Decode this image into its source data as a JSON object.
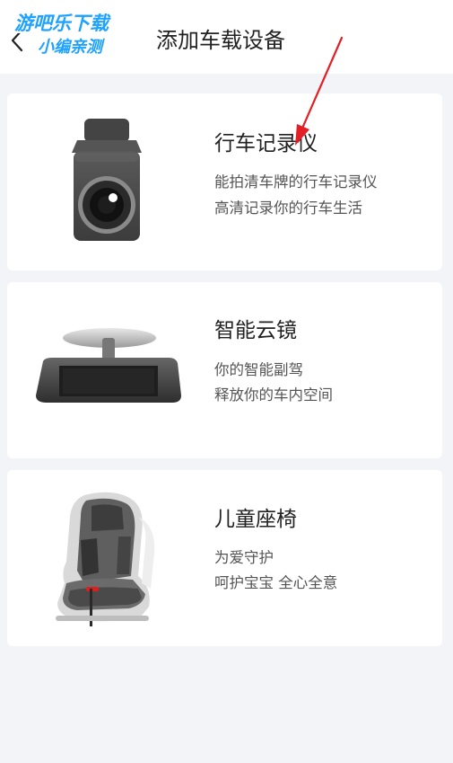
{
  "header": {
    "title": "添加车载设备",
    "watermark_line1": "游吧乐下载",
    "watermark_line2": "小编亲测"
  },
  "devices": [
    {
      "title": "行车记录仪",
      "lines": [
        "能拍清车牌的行车记录仪",
        "高清记录你的行车生活"
      ],
      "icon": "dashcam-icon"
    },
    {
      "title": "智能云镜",
      "lines": [
        "你的智能副驾",
        "释放你的车内空间"
      ],
      "icon": "smart-mirror-icon"
    },
    {
      "title": "儿童座椅",
      "lines": [
        "为爱守护",
        "呵护宝宝 全心全意"
      ],
      "icon": "child-seat-icon"
    }
  ],
  "colors": {
    "background": "#f3f4f7",
    "card": "#ffffff",
    "annotation_arrow": "#e31e24"
  }
}
